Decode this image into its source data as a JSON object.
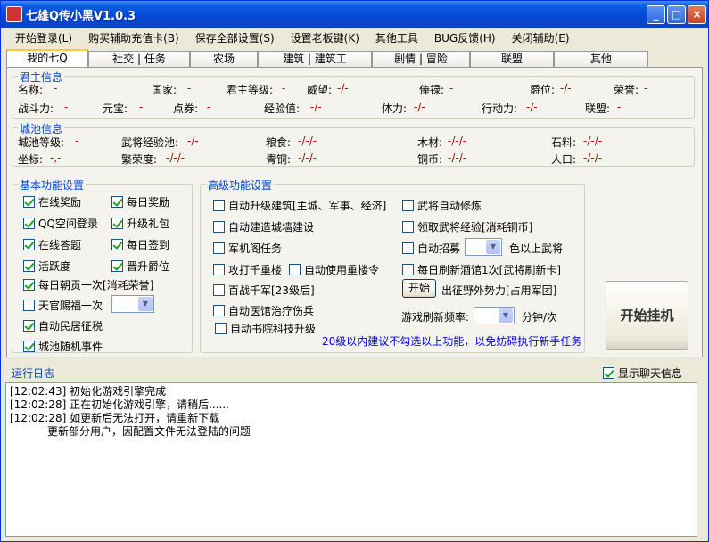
{
  "window": {
    "title": "七雄Q传小黑V1.0.3"
  },
  "window_buttons": {
    "minimize": "_",
    "maximize": "□",
    "close": "×"
  },
  "menu": [
    "开始登录(L)",
    "购买辅助充值卡(B)",
    "保存全部设置(S)",
    "设置老板键(K)",
    "其他工具",
    "BUG反馈(H)",
    "关闭辅助(E)"
  ],
  "tabs": [
    "我的七Q",
    "社交 | 任务",
    "农场",
    "建筑 | 建筑工",
    "剧情 | 冒险",
    "联盟",
    "其他"
  ],
  "monarch": {
    "title": "君主信息",
    "row1": [
      {
        "label": "名称:",
        "value": "-"
      },
      {
        "label": "国家:",
        "value": "-"
      },
      {
        "label": "君主等级:",
        "value": "-"
      },
      {
        "label": "威望:",
        "value": "-/-"
      },
      {
        "label": "俸禄:",
        "value": "-"
      },
      {
        "label": "爵位:",
        "value": "-/-"
      },
      {
        "label": "荣誉:",
        "value": "-"
      }
    ],
    "row2": [
      {
        "label": "战斗力:",
        "value": "-"
      },
      {
        "label": "元宝:",
        "value": "-"
      },
      {
        "label": "点券:",
        "value": "-"
      },
      {
        "label": "经验值:",
        "value": "-/-"
      },
      {
        "label": "体力:",
        "value": "-/-"
      },
      {
        "label": "行动力:",
        "value": "-/-"
      },
      {
        "label": "联盟:",
        "value": "-"
      }
    ]
  },
  "city": {
    "title": "城池信息",
    "row1": [
      {
        "label": "城池等级:",
        "value": "-"
      },
      {
        "label": "武将经验池:",
        "value": "-/-"
      },
      {
        "label": "粮食:",
        "value": "-/-/-"
      },
      {
        "label": "木材:",
        "value": "-/-/-"
      },
      {
        "label": "石料:",
        "value": "-/-/-"
      }
    ],
    "row2": [
      {
        "label": "坐标:",
        "value": "-,-"
      },
      {
        "label": "繁荣度:",
        "value": "-/-/-"
      },
      {
        "label": "青铜:",
        "value": "-/-/-"
      },
      {
        "label": "铜币:",
        "value": "-/-/-"
      },
      {
        "label": "人口:",
        "value": "-/-/-"
      }
    ]
  },
  "basic": {
    "title": "基本功能设置",
    "left": [
      {
        "label": "在线奖励",
        "checked": true
      },
      {
        "label": "QQ空间登录",
        "checked": true
      },
      {
        "label": "在线答题",
        "checked": true
      },
      {
        "label": "活跃度",
        "checked": true
      }
    ],
    "right": [
      {
        "label": "每日奖励",
        "checked": true
      },
      {
        "label": "升级礼包",
        "checked": true
      },
      {
        "label": "每日签到",
        "checked": true
      },
      {
        "label": "晋升爵位",
        "checked": true
      }
    ],
    "wide": [
      {
        "label": "每日朝贡一次[消耗荣誉]",
        "checked": true
      },
      {
        "label": "天官赐福一次",
        "checked": false
      },
      {
        "label": "自动民居征税",
        "checked": true
      },
      {
        "label": "城池随机事件",
        "checked": true
      }
    ]
  },
  "advanced": {
    "title": "高级功能设置",
    "left": [
      {
        "label": "自动升级建筑[主城、军事、经济]",
        "checked": false
      },
      {
        "label": "自动建造城墙建设",
        "checked": false
      },
      {
        "label": "军机阁任务",
        "checked": false
      },
      {
        "label": "攻打千重楼",
        "checked": false
      },
      {
        "label": "百战千军[23级后]",
        "checked": false
      },
      {
        "label": "自动医馆治疗伤兵",
        "checked": false
      },
      {
        "label": "自动书院科技升级",
        "checked": false
      }
    ],
    "use_token": {
      "label": "自动使用重楼令",
      "checked": false
    },
    "right": [
      {
        "label": "武将自动修炼",
        "checked": false
      },
      {
        "label": "领取武将经验[消耗铜币]",
        "checked": false
      },
      {
        "label": "自动招募",
        "checked": false
      },
      {
        "label": "每日刷新酒馆1次[武将刷新卡]",
        "checked": false
      }
    ],
    "recruit_suffix": "色以上武将",
    "start_button": "开始",
    "expedition_label": "出征野外势力[占用军团]",
    "refresh_label": "游戏刷新频率:",
    "refresh_unit": "分钟/次",
    "tip": "20级以内建议不勾选以上功能，以免妨碍执行新手任务"
  },
  "start_hook_button": "开始挂机",
  "log": {
    "title": "运行日志",
    "show_chat": {
      "label": "显示聊天信息",
      "checked": true
    },
    "lines": [
      "[12:02:43] 初始化游戏引擎完成",
      "[12:02:28] 正在初始化游戏引擎，请稍后......",
      "[12:02:28] 如更新后无法打开，请重新下载",
      "           更新部分用户，因配置文件无法登陆的问题"
    ]
  }
}
